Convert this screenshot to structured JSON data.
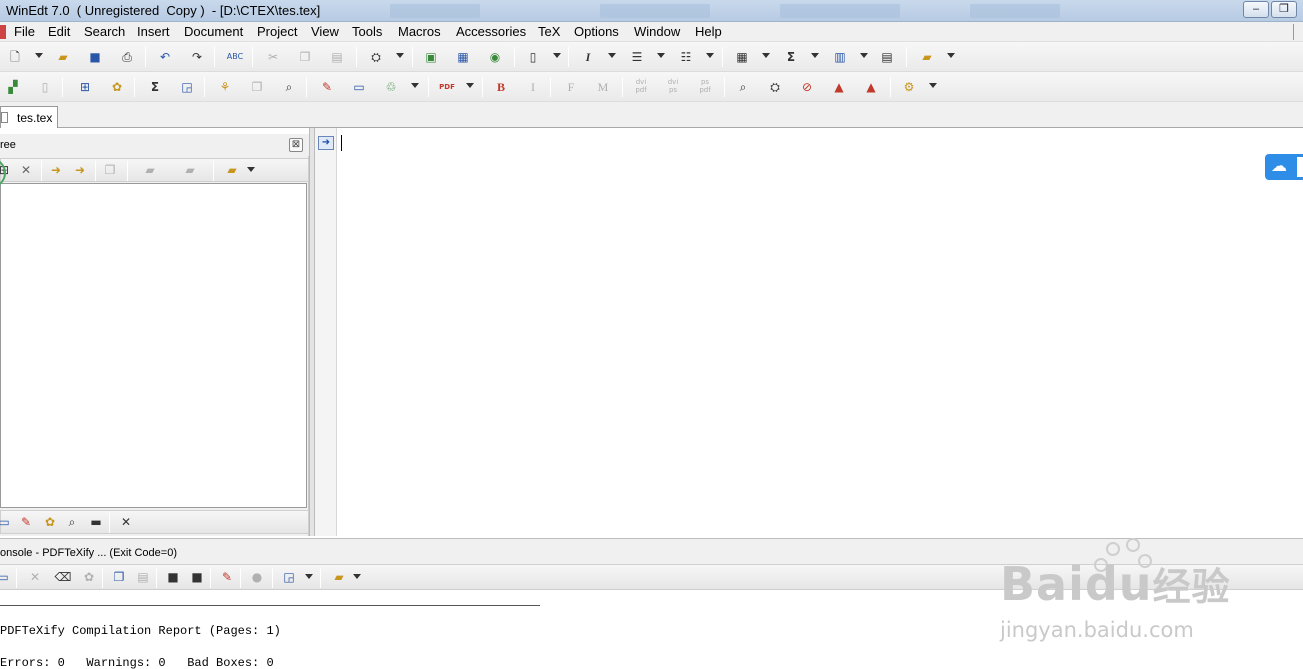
{
  "window": {
    "title": "WinEdt 7.0  ( Unregistered  Copy )  - [D:\\CTEX\\tes.tex]",
    "controls": [
      "–",
      "❐"
    ]
  },
  "menu": [
    "File",
    "Edit",
    "Search",
    "Insert",
    "Document",
    "Project",
    "View",
    "Tools",
    "Macros",
    "Accessories",
    "TeX",
    "Options",
    "Window",
    "Help"
  ],
  "toolbar1": {
    "icons": [
      "new-file-icon",
      "open-folder-icon",
      "save-icon",
      "print-icon",
      "undo-icon",
      "redo-icon",
      "spell-check-icon",
      "cut-icon",
      "copy-icon",
      "paste-icon",
      "find-icon",
      "image-icon",
      "table-icon",
      "web-icon",
      "document-icon",
      "italic-icon",
      "align-icon",
      "list-icon",
      "grid-icon",
      "sigma-icon",
      "book-icon",
      "page-icon",
      "folder-icon"
    ]
  },
  "toolbar2": {
    "text_buttons": {
      "bold": "B",
      "italic": "I",
      "f": "F",
      "m": "M",
      "dvipdf": "dvi\npdf",
      "dvips": "dvi\nps",
      "pspdf": "ps\npdf",
      "pdf": "PDF"
    }
  },
  "tab": {
    "label": "tes.tex"
  },
  "tree_pane": {
    "title": "ree",
    "close": "⊠"
  },
  "console": {
    "title": "onsole - PDFTeXify ... (Exit Code=0)",
    "report_line": "PDFTeXify Compilation Report (Pages: 1)",
    "stats_line": "Errors: 0   Warnings: 0   Bad Boxes: 0"
  },
  "watermark": {
    "brand": "Bai",
    "brand2": "du",
    "cn": "经验",
    "url": "jingyan.baidu.com"
  },
  "colors": {
    "accent": "#2e8de6",
    "ring": "#4aa862"
  }
}
